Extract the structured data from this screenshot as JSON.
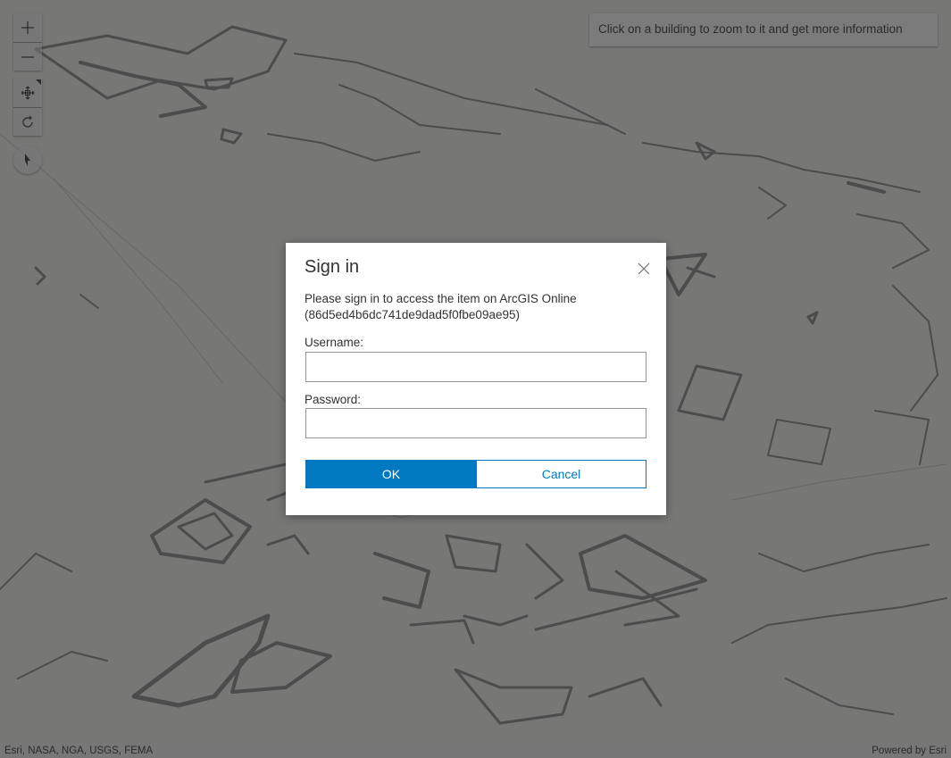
{
  "map": {
    "info_text": "Click on a building to zoom to it and get more information",
    "controls": {
      "zoom_in_icon": "plus-icon",
      "zoom_out_icon": "minus-icon",
      "pan_icon": "move-arrows-icon",
      "rotate_icon": "rotate-icon",
      "compass_icon": "compass-needle-icon"
    },
    "attribution": {
      "sources": "Esri, NASA, NGA, USGS, FEMA",
      "powered_by": "Powered by Esri"
    }
  },
  "dialog": {
    "title": "Sign in",
    "message": "Please sign in to access the item on ArcGIS Online (86d5ed4b6dc741de9dad5f0fbe09ae95)",
    "username_label": "Username:",
    "username_value": "",
    "password_label": "Password:",
    "password_value": "",
    "ok_label": "OK",
    "cancel_label": "Cancel",
    "close_icon": "close-icon"
  },
  "colors": {
    "accent": "#0079c1",
    "overlay": "#3c3c3c",
    "dialog_background": "#ffffff",
    "text": "#323232"
  }
}
